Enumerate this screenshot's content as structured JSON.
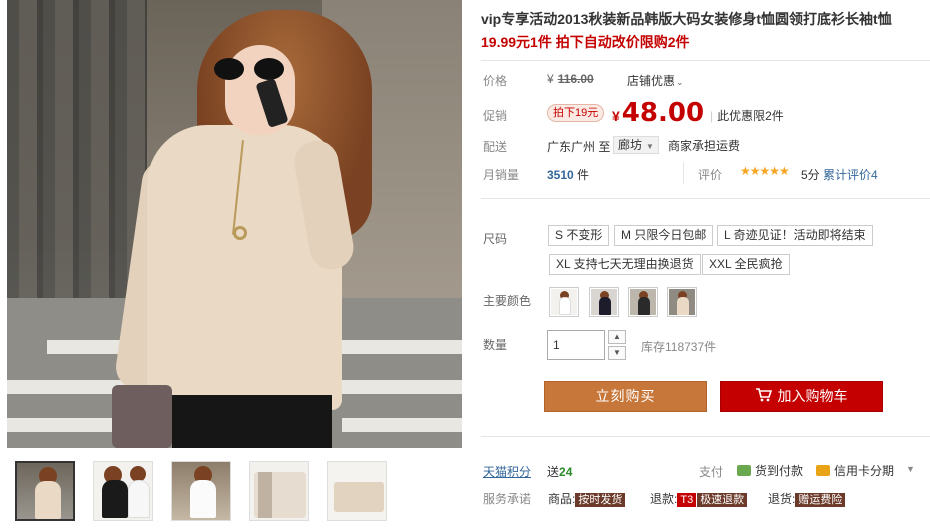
{
  "product": {
    "title": "vip专享活动2013秋装新品韩版大码女装修身t恤圆领打底衫长袖t恤",
    "subtitle": "19.99元1件 拍下自动改价限购2件"
  },
  "price": {
    "label": "价格",
    "currency": "¥",
    "original": "116.00",
    "store_promo": "店铺优惠"
  },
  "promo": {
    "label": "促销",
    "badge": "拍下19元",
    "currency": "¥",
    "price": "48.00",
    "limit": "此优惠限2件"
  },
  "shipping": {
    "label": "配送",
    "from": "广东广州 至",
    "to": "廊坊",
    "fee": "商家承担运费"
  },
  "sales": {
    "label": "月销量",
    "count": "3510",
    "unit": "件",
    "rating_label": "评价",
    "stars": "★★★★★",
    "score": "5分",
    "rating_link": "累计评价4"
  },
  "size": {
    "label": "尺码",
    "options": [
      "S 不变形",
      "M 只限今日包邮",
      "L 奇迹见证！活动即将结束",
      "XL 支持七天无理由换退货",
      "XXL 全民疯抢"
    ]
  },
  "color": {
    "label": "主要颜色"
  },
  "quantity": {
    "label": "数量",
    "value": "1",
    "stock": "库存118737件"
  },
  "actions": {
    "buy_now": "立刻购买",
    "add_to_cart": "加入购物车"
  },
  "points": {
    "label": "天猫积分",
    "send_prefix": "送",
    "value": "24"
  },
  "payment": {
    "label": "支付",
    "cod": "货到付款",
    "credit_card": "信用卡分期"
  },
  "service": {
    "label": "服务承诺",
    "item1_prefix": "商品:",
    "item1_tag": "按时发货",
    "item2_prefix": "退款:",
    "item2_tag_a": "T3",
    "item2_tag_b": "极速退款",
    "item3_prefix": "退货:",
    "item3_tag": "赠运费险"
  },
  "colors": {
    "accent_red": "#c40000",
    "buy_button": "#c8773a",
    "link_blue": "#336699"
  },
  "icons": {
    "store_promo": "chevron-down-icon",
    "ship_dest": "dropdown-arrow-icon",
    "cart": "shopping-cart-icon",
    "cod": "truck-icon",
    "credit_card": "credit-card-icon",
    "more": "chevron-down-icon"
  }
}
